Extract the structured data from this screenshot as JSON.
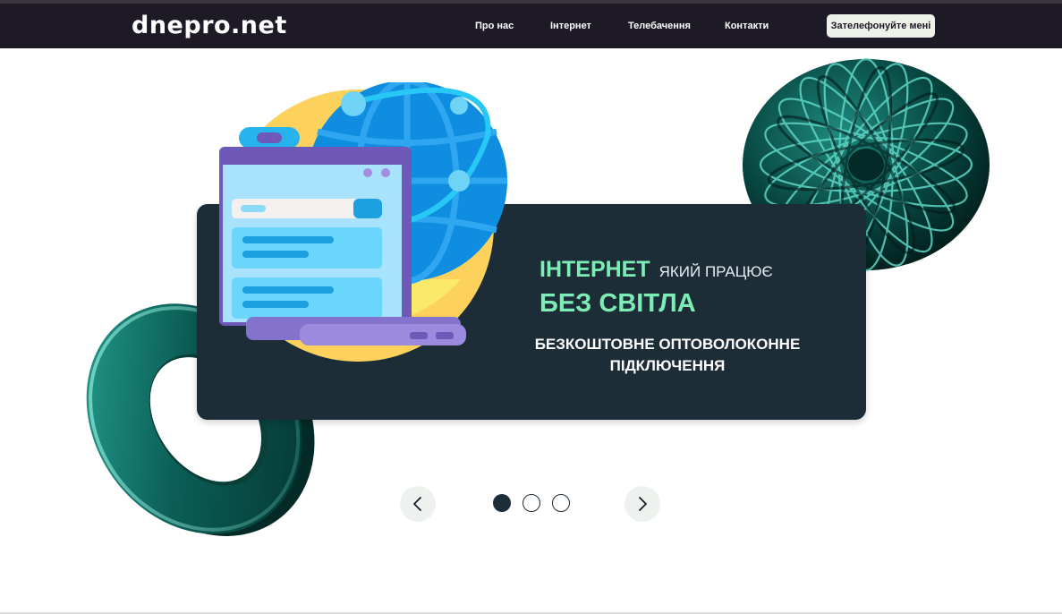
{
  "header": {
    "logo": "dnepro.net",
    "nav": [
      "Про нас",
      "Інтернет",
      "Телебачення",
      "Контакти"
    ],
    "cta_label": "Зателефонуйте мені"
  },
  "hero": {
    "headline_accent": "ІНТЕРНЕТ",
    "headline_small": "ЯКИЙ ПРАЦЮЄ",
    "headline_big": "БЕЗ СВІТЛА",
    "subtitle": "БЕЗКОШТОВНЕ ОПТОВОЛОКОННЕ ПІДКЛЮЧЕННЯ"
  },
  "slider": {
    "prev_icon": "chevron-left-icon",
    "next_icon": "chevron-right-icon",
    "slide_count": 3,
    "active_slide": 1
  },
  "colors": {
    "header_bg": "#1d1925",
    "card_bg": "#1c2d38",
    "accent_green": "#7dedb6",
    "teal_deco": "#0e6e66"
  }
}
